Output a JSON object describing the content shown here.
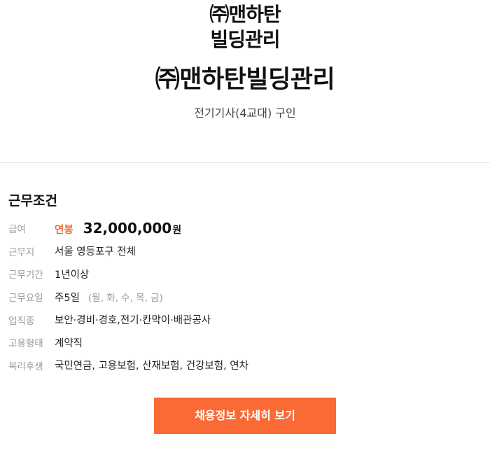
{
  "header": {
    "logo_line1": "㈜맨하탄",
    "logo_line2": "빌딩관리",
    "company_name": "㈜맨하탄빌딩관리",
    "job_title": "전기기사(4교대) 구인"
  },
  "conditions": {
    "title": "근무조건",
    "salary": {
      "label": "급여",
      "type": "연봉",
      "amount": "32,000,000",
      "unit": "원"
    },
    "location": {
      "label": "근무지",
      "value": "서울 영등포구 전체"
    },
    "period": {
      "label": "근무기간",
      "value": "1년이상"
    },
    "days": {
      "label": "근무요일",
      "value": "주5일",
      "detail": "(월, 화, 수, 목, 금)"
    },
    "industry": {
      "label": "업직종",
      "value": "보안·경비·경호,전기·칸막이·배관공사"
    },
    "employment": {
      "label": "고용형태",
      "value": "계약직"
    },
    "benefits": {
      "label": "복리후생",
      "value": "국민연금, 고용보험, 산재보험, 건강보험, 연차"
    }
  },
  "cta": {
    "label": "채용정보 자세히 보기"
  },
  "colors": {
    "accent": "#f96a35",
    "salary_type": "#f26a3a",
    "label_gray": "#9a9a9a"
  }
}
